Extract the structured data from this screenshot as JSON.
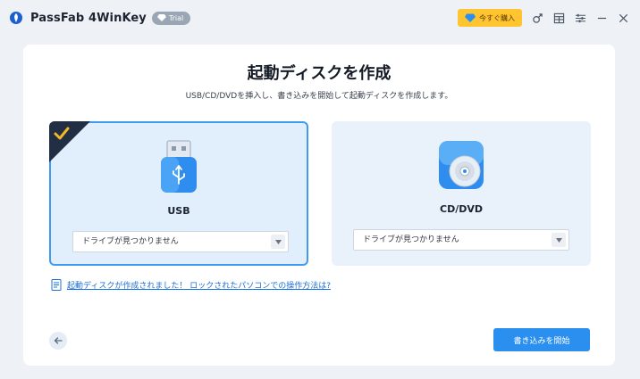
{
  "app": {
    "title": "PassFab 4WinKey",
    "trial_label": "Trial"
  },
  "titlebar": {
    "buy_label": "今すぐ購入",
    "icons": [
      "user-icon",
      "menu-grid-icon",
      "settings-sliders-icon",
      "minimize-icon",
      "close-icon"
    ]
  },
  "main": {
    "title": "起動ディスクを作成",
    "subtitle": "USB/CD/DVDを挿入し、書き込みを開始して起動ディスクを作成します。",
    "options": [
      {
        "label": "USB",
        "selected": true,
        "dropdown_value": "ドライブが見つかりません",
        "icon": "usb-drive-icon"
      },
      {
        "label": "CD/DVD",
        "selected": false,
        "dropdown_value": "ドライブが見つかりません",
        "icon": "cd-dvd-icon"
      }
    ],
    "help_link": "起動ディスクが作成されました！ ロックされたパソコンでの操作方法は?",
    "start_button": "書き込みを開始"
  },
  "colors": {
    "accent": "#2b8ff0",
    "selected_border": "#3f9bef",
    "buy": "#ffc531",
    "corner": "#222e44"
  }
}
